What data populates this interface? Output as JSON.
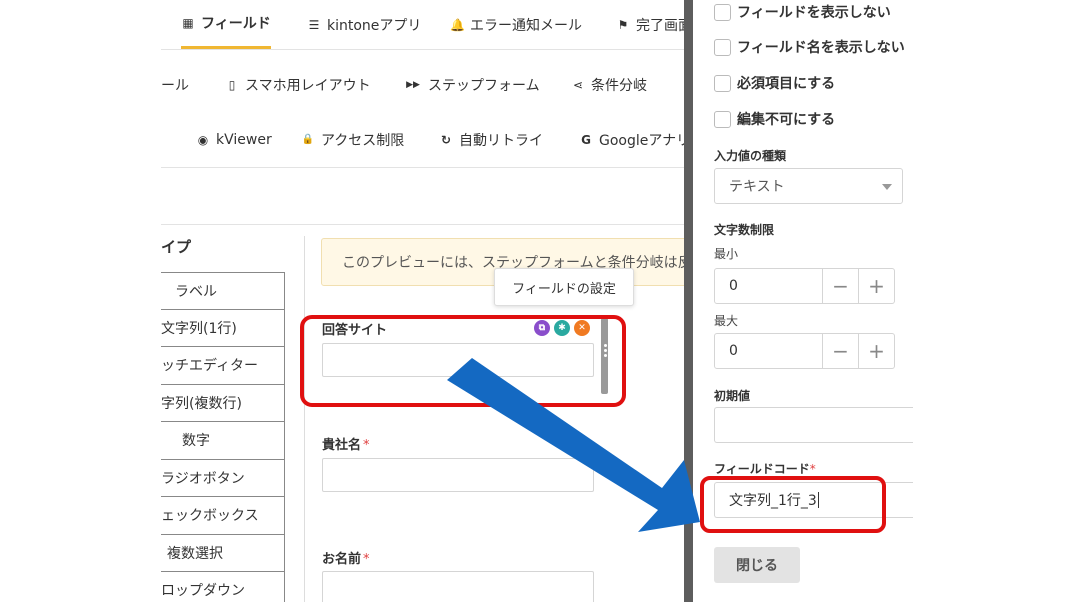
{
  "tabs_row1": [
    {
      "icon": "grid-icon",
      "glyph": "▦",
      "label": "フィールド",
      "active": true
    },
    {
      "icon": "list-icon",
      "glyph": "☰",
      "label": "kintoneアプリ"
    },
    {
      "icon": "bell-icon",
      "glyph": "🔔",
      "label": "エラー通知メール"
    },
    {
      "icon": "flag-icon",
      "glyph": "⚑",
      "label": "完了画面"
    }
  ],
  "tabs_row2": [
    {
      "icon": "",
      "glyph": "",
      "label": "ール"
    },
    {
      "icon": "mobile-icon",
      "glyph": "▯",
      "label": "スマホ用レイアウト"
    },
    {
      "icon": "fast-forward-icon",
      "glyph": "▶▶",
      "label": "ステップフォーム"
    },
    {
      "icon": "branch-icon",
      "glyph": "⋖",
      "label": "条件分岐"
    }
  ],
  "tabs_row3": [
    {
      "icon": "eye-icon",
      "glyph": "◉",
      "label": "kViewer"
    },
    {
      "icon": "lock-icon",
      "glyph": "🔒",
      "label": "アクセス制限"
    },
    {
      "icon": "retry-icon",
      "glyph": "↻",
      "label": "自動リトライ"
    },
    {
      "icon": "google-icon",
      "glyph": "G",
      "label": "Googleアナリ"
    }
  ],
  "field_types": {
    "header": "イプ",
    "items": [
      "ラベル",
      "文字列(1行)",
      "ッチエディター",
      "字列(複数行)",
      "数字",
      "ラジオボタン",
      "ェックボックス",
      "複数選択",
      "ロップダウン"
    ]
  },
  "notice": "このプレビューには、ステップフォームと条件分岐は反",
  "tooltip": "フィールドの設定",
  "form": {
    "field1_label": "回答サイト",
    "field2_label": "貴社名",
    "field3_label": "お名前",
    "required_mark": "*"
  },
  "panel": {
    "checkboxes": [
      "フィールドを表示しない",
      "フィールド名を表示しない",
      "必須項目にする",
      "編集不可にする"
    ],
    "input_type_label": "入力値の種類",
    "input_type_value": "テキスト",
    "char_limit_label": "文字数制限",
    "min_label": "最小",
    "min_value": "0",
    "max_label": "最大",
    "max_value": "0",
    "minus": "−",
    "plus": "+",
    "default_label": "初期値",
    "default_value": "",
    "field_code_label": "フィールドコード",
    "field_code_value": "文字列_1行_3",
    "close_label": "閉じる"
  },
  "colors": {
    "highlight": "#e01010",
    "arrow": "#1469c2",
    "active_tab": "#f0b732"
  }
}
